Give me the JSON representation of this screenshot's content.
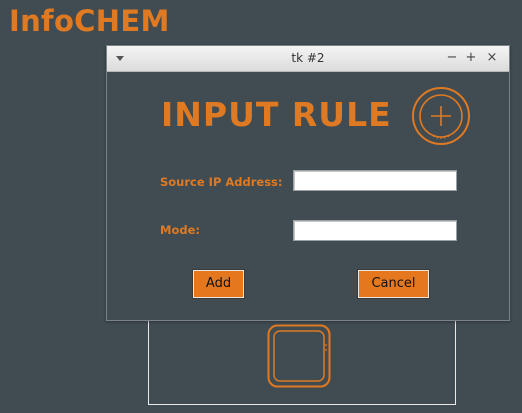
{
  "app": {
    "title": "InfoCHEM"
  },
  "dialog": {
    "title": "tk #2",
    "controls": {
      "minimize": "−",
      "maximize": "+",
      "close": "×"
    },
    "heading": "INPUT RULE",
    "fields": {
      "source_ip": {
        "label": "Source IP Address:",
        "value": ""
      },
      "mode": {
        "label": "Mode:",
        "value": ""
      }
    },
    "buttons": {
      "add": "Add",
      "cancel": "Cancel"
    }
  },
  "colors": {
    "accent": "#e07a22",
    "background": "#404c52",
    "button": "#e5781f"
  },
  "icons": {
    "heading_icon": "circle-plus-icon",
    "background_icon": "rounded-square-icon"
  }
}
